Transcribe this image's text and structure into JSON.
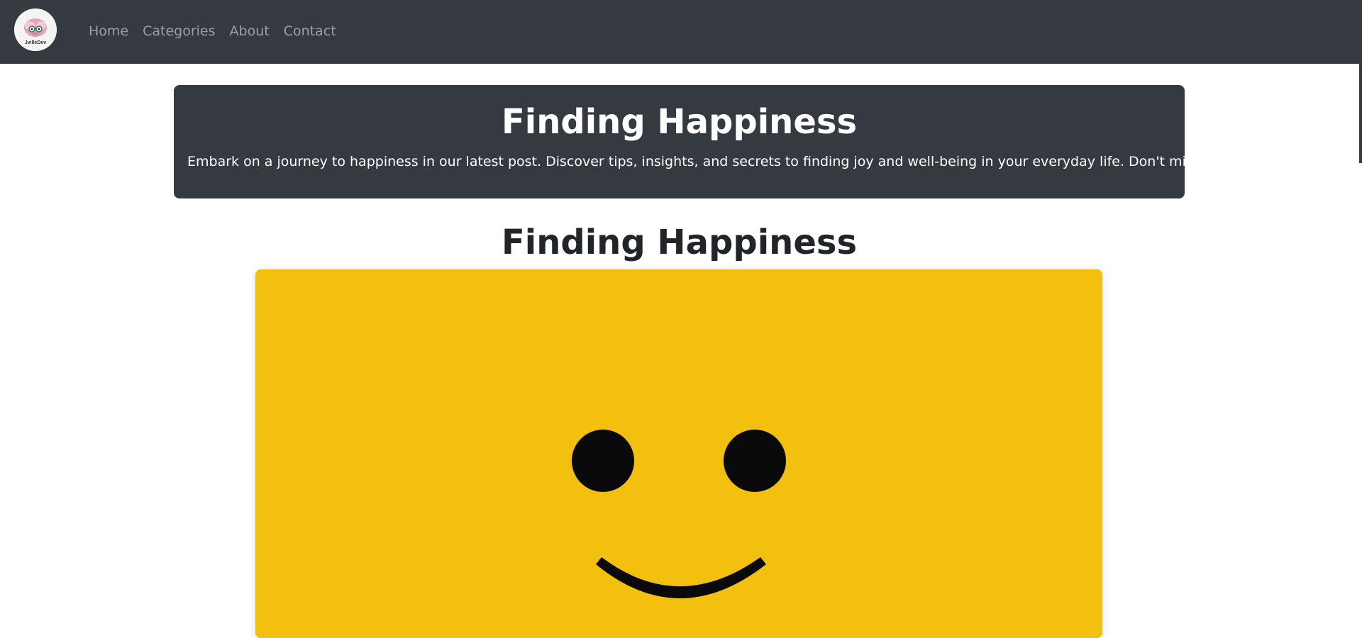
{
  "navbar": {
    "logo_text": "JvilleDev",
    "links": [
      {
        "label": "Home"
      },
      {
        "label": "Categories"
      },
      {
        "label": "About"
      },
      {
        "label": "Contact"
      }
    ]
  },
  "hero": {
    "title": "Finding Happiness",
    "description": "Embark on a journey to happiness in our latest post. Discover tips, insights, and secrets to finding joy and well-being in your everyday life. Don't miss it!"
  },
  "post": {
    "title": "Finding Happiness",
    "image_icon": "smiley-face-image"
  },
  "colors": {
    "navbar_bg": "#343a40",
    "nav_link": "#9aa0a6",
    "image_yellow": "#f3c00f",
    "face_black": "#0a0a0c"
  }
}
